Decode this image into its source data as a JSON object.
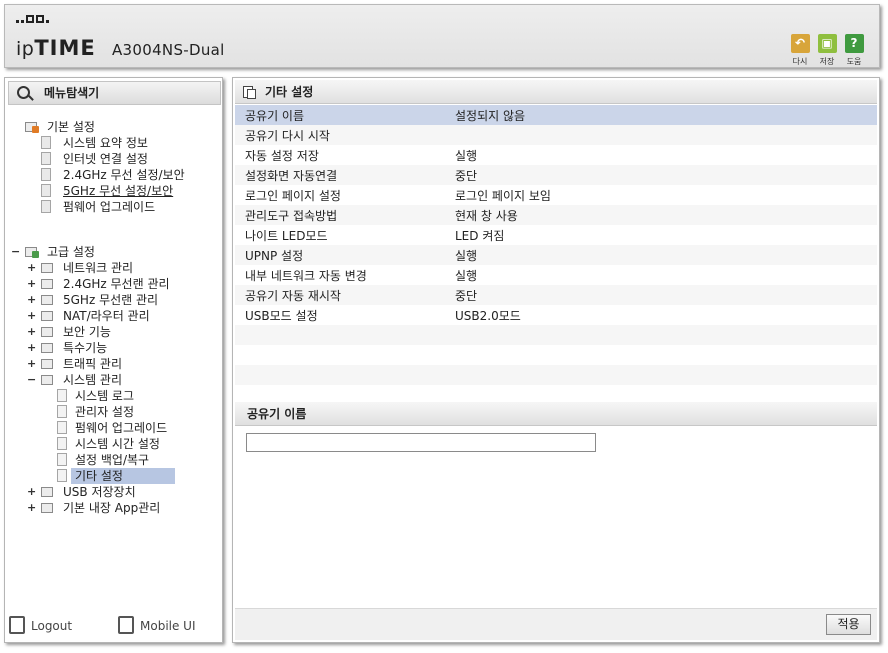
{
  "header": {
    "brand": "ipTIME",
    "model": "A3004NS-Dual",
    "buttons": [
      {
        "label": "다시",
        "icon": "undo-icon",
        "color": "#d8a53a"
      },
      {
        "label": "저장",
        "icon": "save-icon",
        "color": "#8fbf3f"
      },
      {
        "label": "도움",
        "icon": "help-icon",
        "color": "#3f9a3f"
      }
    ]
  },
  "sidebar": {
    "title": "메뉴탐색기",
    "basic_group": "기본 설정",
    "basic_items": [
      "시스템 요약 정보",
      "인터넷 연결 설정",
      "2.4GHz 무선 설정/보안",
      "5GHz 무선 설정/보안",
      "펌웨어 업그레이드"
    ],
    "advanced_group": "고급 설정",
    "advanced_items": [
      "네트워크 관리",
      "2.4GHz 무선랜 관리",
      "5GHz 무선랜 관리",
      "NAT/라우터 관리",
      "보안 기능",
      "특수기능",
      "트래픽 관리",
      "시스템 관리"
    ],
    "system_items": [
      "시스템 로그",
      "관리자 설정",
      "펌웨어 업그레이드",
      "시스템 시간 설정",
      "설정 백업/복구",
      "기타 설정"
    ],
    "more_items": [
      "USB 저장장치",
      "기본 내장 App관리"
    ],
    "logout": "Logout",
    "mobile_ui": "Mobile UI"
  },
  "main": {
    "section_title": "기타 설정",
    "rows": [
      {
        "key": "공유기 이름",
        "value": "설정되지 않음"
      },
      {
        "key": "공유기 다시 시작",
        "value": ""
      },
      {
        "key": "자동 설정 저장",
        "value": "실행"
      },
      {
        "key": "설정화면 자동연결",
        "value": "중단"
      },
      {
        "key": "로그인 페이지 설정",
        "value": "로그인 페이지 보임"
      },
      {
        "key": "관리도구 접속방법",
        "value": "현재 창 사용"
      },
      {
        "key": "나이트 LED모드",
        "value": "LED 켜짐"
      },
      {
        "key": "UPNP 설정",
        "value": "실행"
      },
      {
        "key": "내부 네트워크 자동 변경",
        "value": "실행"
      },
      {
        "key": "공유기 자동 재시작",
        "value": "중단"
      },
      {
        "key": "USB모드 설정",
        "value": "USB2.0모드"
      }
    ],
    "form_title": "공유기 이름",
    "name_input_value": "",
    "apply_label": "적용"
  }
}
